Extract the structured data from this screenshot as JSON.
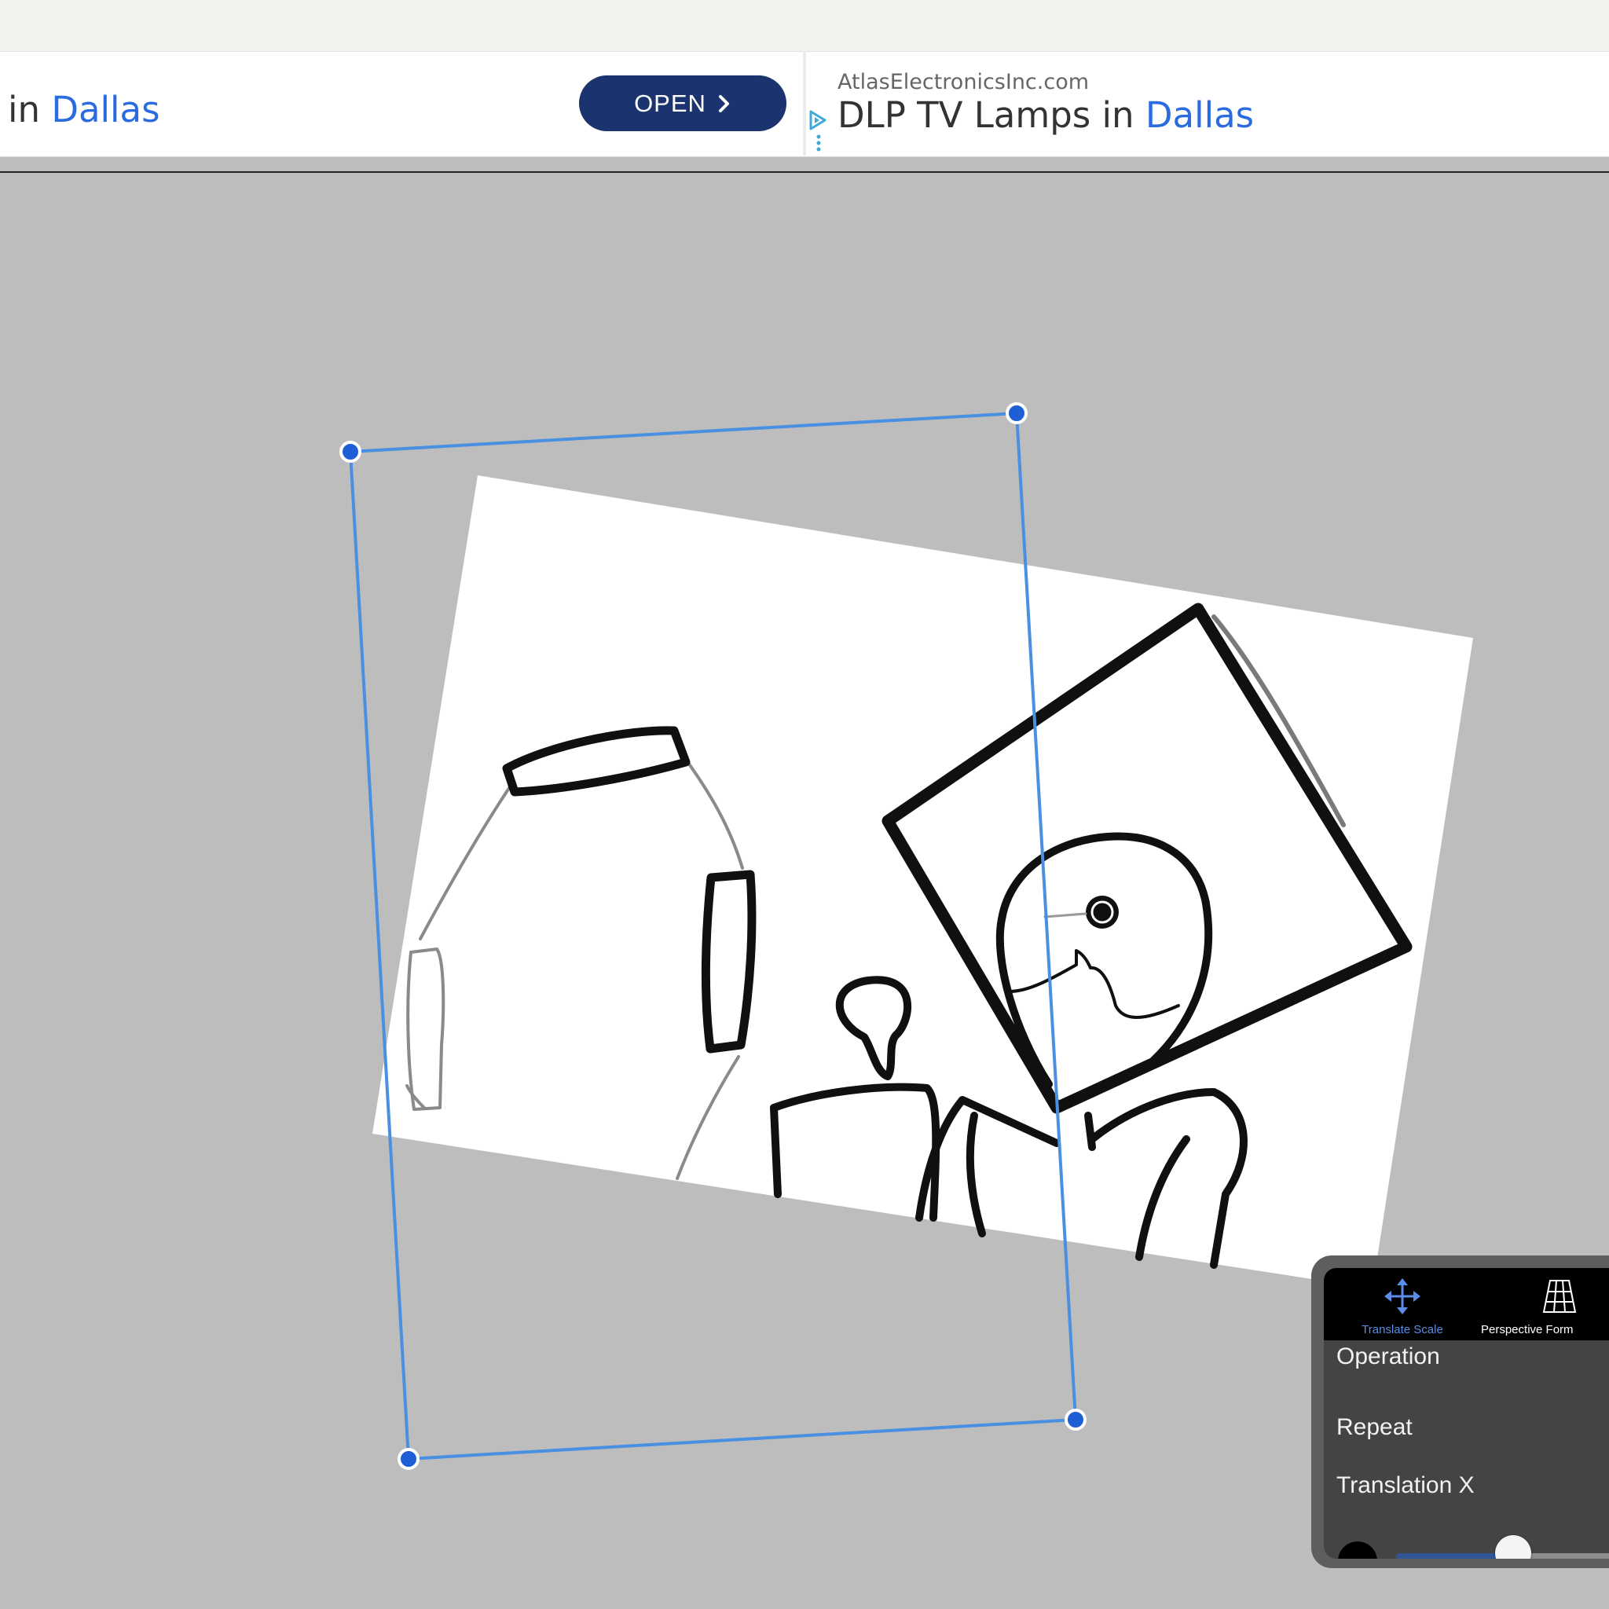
{
  "ad_left": {
    "headline_prefix": "in ",
    "headline_city": "Dallas",
    "open_label": "OPEN",
    "open_chevron": "chevron-right-icon"
  },
  "ad_right": {
    "domain": "AtlasElectronicsInc.com",
    "headline_prefix": "DLP TV Lamps in ",
    "headline_city": "Dallas",
    "adchoices_icon": "adchoices-icon"
  },
  "transform_panel": {
    "modes": [
      {
        "label": "Translate Scale",
        "icon": "move-arrows-icon",
        "active": true
      },
      {
        "label": "Perspective Form",
        "icon": "perspective-grid-icon",
        "active": false
      }
    ],
    "settings": {
      "operation_label": "Operation",
      "repeat_label": "Repeat",
      "translation_x_label": "Translation X"
    },
    "translation_x_fraction": 0.45
  },
  "colors": {
    "accent_blue": "#4a90e2",
    "handle_blue": "#1f5fd6",
    "ad_button": "#1b3470",
    "link_blue": "#2a6be0"
  }
}
